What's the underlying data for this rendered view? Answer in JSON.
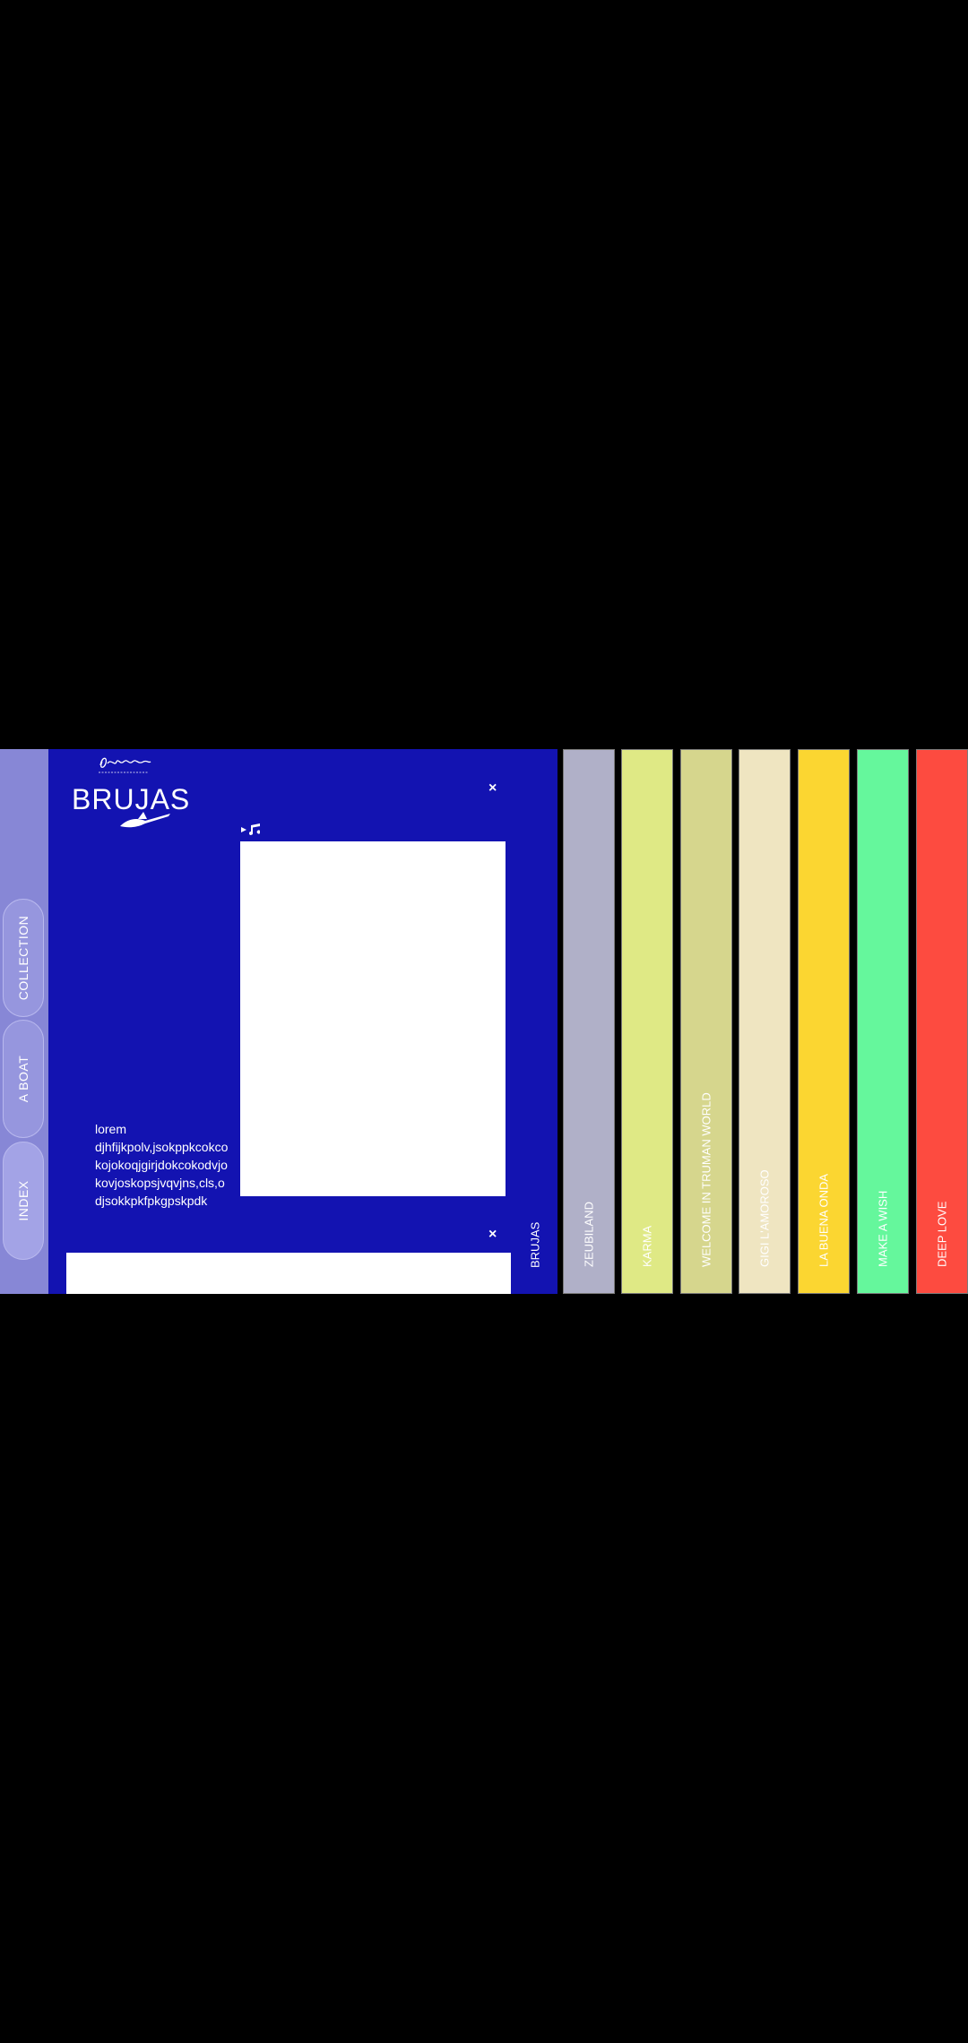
{
  "rail": {
    "items": [
      {
        "label": "COLLECTION"
      },
      {
        "label": "A BOAT"
      },
      {
        "label": "INDEX"
      }
    ]
  },
  "panel": {
    "title": "BRUJAS",
    "description": "lorem djhfijkpolv,jsokppkcokcokojokoqjgirjdokcokodvjokovjoskopsjvqvjns,cls,odjsokkpkfpkgpskpdk",
    "close_symbol": "×"
  },
  "tabs": [
    {
      "label": "BRUJAS",
      "color": "#1313b1",
      "text_color": "#ffffff"
    },
    {
      "label": "ZEUBILAND",
      "color": "#b0b0c8",
      "text_color": "#ffffff"
    },
    {
      "label": "KARMA",
      "color": "#dfe985",
      "text_color": "#ffffff"
    },
    {
      "label": "WELCOME IN TRUMAN WORLD",
      "color": "#d6d68d",
      "text_color": "#ffffff"
    },
    {
      "label": "GIGI L'AMOROSO",
      "color": "#efe5c1",
      "text_color": "#ffffff"
    },
    {
      "label": "LA BUENA ONDA",
      "color": "#fbd631",
      "text_color": "#ffffff"
    },
    {
      "label": "MAKE A WISH",
      "color": "#65f79c",
      "text_color": "#ffffff"
    },
    {
      "label": "DEEP LOVE",
      "color": "#fd4b40",
      "text_color": "#ffffff"
    }
  ]
}
